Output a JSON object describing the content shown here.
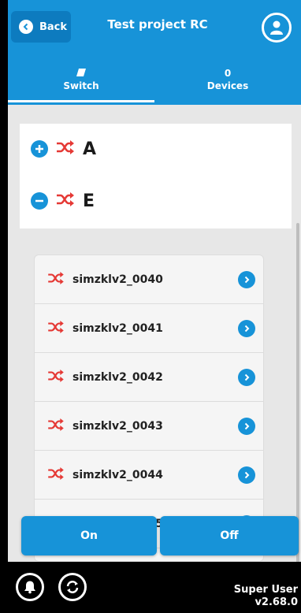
{
  "header": {
    "back_label": "Back",
    "title": "Test project RC"
  },
  "tabs": [
    {
      "label": "Switch",
      "badge": "",
      "active": true
    },
    {
      "label": "Devices",
      "badge": "0",
      "active": false
    }
  ],
  "groups": [
    {
      "letter": "A",
      "state": "collapsed"
    },
    {
      "letter": "E",
      "state": "expanded"
    }
  ],
  "devices": [
    {
      "name": "simzklv2_0040"
    },
    {
      "name": "simzklv2_0041"
    },
    {
      "name": "simzklv2_0042"
    },
    {
      "name": "simzklv2_0043"
    },
    {
      "name": "simzklv2_0044"
    },
    {
      "name": "simzklv2_0045"
    }
  ],
  "actions": {
    "on_label": "On",
    "off_label": "Off"
  },
  "footer": {
    "user": "Super User",
    "version": "v2.68.0"
  },
  "colors": {
    "accent": "#1793d8",
    "shuffle": "#e53935",
    "background": "#e7e7e7"
  }
}
